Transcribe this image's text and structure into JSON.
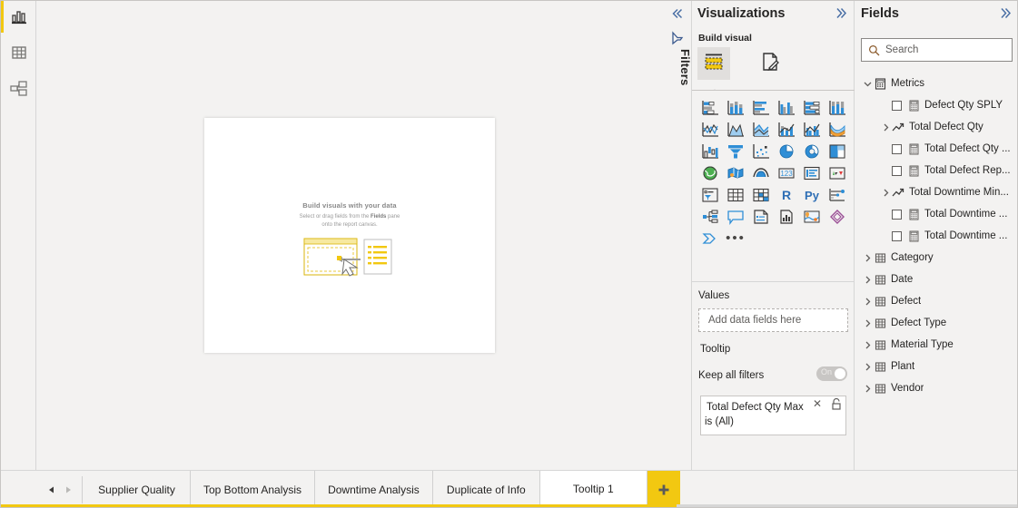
{
  "left_rail": {
    "items": [
      {
        "name": "report-view",
        "icon": "bar-chart-icon",
        "selected": true
      },
      {
        "name": "data-view",
        "icon": "table-icon",
        "selected": false
      },
      {
        "name": "model-view",
        "icon": "relationships-icon",
        "selected": false
      }
    ],
    "accent_color": "#f2c811"
  },
  "canvas": {
    "placeholder_title": "Build visuals with your data",
    "placeholder_line1_a": "Select or drag fields from the ",
    "placeholder_line1_b": "Fields",
    "placeholder_line1_c": " pane",
    "placeholder_line2": "onto the report canvas."
  },
  "filters_strip": {
    "collapse_icon": "double-chevron-left-icon",
    "filter_icon": "filter-funnel-icon",
    "label": "Filters"
  },
  "visualizations": {
    "title": "Visualizations",
    "expand_icon": "double-chevron-right-icon",
    "build_visual_label": "Build visual",
    "tabs": [
      {
        "name": "build-visual-tab",
        "icon": "fields-well-icon",
        "selected": true
      },
      {
        "name": "format-visual-tab",
        "icon": "paint-brush-icon",
        "selected": false
      }
    ],
    "icons": [
      "stacked-bar-chart",
      "stacked-column-chart",
      "clustered-bar-chart",
      "clustered-column-chart",
      "100-percent-stacked-bar-chart",
      "100-percent-stacked-column-chart",
      "line-chart",
      "area-chart",
      "stacked-area-chart",
      "line-and-stacked-column-chart",
      "line-and-clustered-column-chart",
      "ribbon-chart",
      "waterfall-chart",
      "funnel-chart",
      "scatter-chart",
      "pie-chart",
      "donut-chart",
      "treemap",
      "map",
      "filled-map",
      "azure-map",
      "card",
      "multi-row-card",
      "kpi",
      "slicer",
      "table",
      "matrix",
      "r-script-visual",
      "python-visual",
      "key-influencers",
      "decomposition-tree",
      "qna-visual",
      "smart-narrative",
      "metrics-visual",
      "paginated-report",
      "power-apps-visual",
      "power-automate-visual",
      "more-options"
    ],
    "values": {
      "section_label": "Values",
      "drop_placeholder": "Add data fields here"
    },
    "tooltip": {
      "section_label": "Tooltip",
      "keep_all_filters_label": "Keep all filters",
      "toggle_state": "On",
      "filter_card": {
        "field_name": "Total Defect Qty Max",
        "condition": "is (All)",
        "remove_icon": "close-x-icon",
        "lock_icon": "lock-icon"
      }
    },
    "highlight_color": "#e81123"
  },
  "fields": {
    "title": "Fields",
    "expand_icon": "double-chevron-right-icon",
    "search": {
      "placeholder": "Search",
      "value": "",
      "icon": "search-icon"
    },
    "tree": [
      {
        "label": "Metrics",
        "level": 0,
        "icon": "measure-table-icon",
        "expander": "chevron-down",
        "checkbox": false
      },
      {
        "label": "Defect Qty SPLY",
        "level": 1,
        "icon": "calculator-icon",
        "expander": "none",
        "checkbox": true
      },
      {
        "label": "Total Defect Qty",
        "level": 1,
        "icon": "trend-line-icon",
        "expander": "chevron-right",
        "checkbox": false
      },
      {
        "label": "Total Defect Qty ...",
        "level": 1,
        "icon": "calculator-icon",
        "expander": "none",
        "checkbox": true
      },
      {
        "label": "Total Defect Rep...",
        "level": 1,
        "icon": "calculator-icon",
        "expander": "none",
        "checkbox": true
      },
      {
        "label": "Total Downtime Min...",
        "level": 1,
        "icon": "trend-line-icon",
        "expander": "chevron-right",
        "checkbox": false
      },
      {
        "label": "Total Downtime ...",
        "level": 1,
        "icon": "calculator-icon",
        "expander": "none",
        "checkbox": true
      },
      {
        "label": "Total Downtime ...",
        "level": 1,
        "icon": "calculator-icon",
        "expander": "none",
        "checkbox": true
      },
      {
        "label": "Category",
        "level": 0,
        "icon": "table-icon",
        "expander": "chevron-right",
        "checkbox": false
      },
      {
        "label": "Date",
        "level": 0,
        "icon": "table-icon",
        "expander": "chevron-right",
        "checkbox": false
      },
      {
        "label": "Defect",
        "level": 0,
        "icon": "table-icon",
        "expander": "chevron-right",
        "checkbox": false
      },
      {
        "label": "Defect Type",
        "level": 0,
        "icon": "table-icon",
        "expander": "chevron-right",
        "checkbox": false
      },
      {
        "label": "Material Type",
        "level": 0,
        "icon": "table-icon",
        "expander": "chevron-right",
        "checkbox": false
      },
      {
        "label": "Plant",
        "level": 0,
        "icon": "table-icon",
        "expander": "chevron-right",
        "checkbox": false
      },
      {
        "label": "Vendor",
        "level": 0,
        "icon": "table-icon",
        "expander": "chevron-right",
        "checkbox": false
      }
    ]
  },
  "tabbar": {
    "prev_icon": "triangle-left-icon",
    "next_icon": "triangle-right-icon",
    "tabs": [
      {
        "label": "Supplier Quality",
        "active": false
      },
      {
        "label": "Top Bottom Analysis",
        "active": false
      },
      {
        "label": "Downtime Analysis",
        "active": false
      },
      {
        "label": "Duplicate of Info",
        "active": false
      },
      {
        "label": "Tooltip 1",
        "active": true
      }
    ],
    "add_page": {
      "label": "+",
      "name": "add-page-button",
      "color": "#f2c811"
    }
  }
}
